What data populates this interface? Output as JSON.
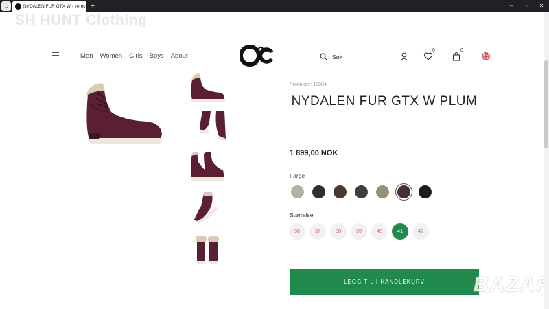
{
  "browser": {
    "tab_title": "NYDALEN FUR GTX W - zeroc",
    "tab_close": "×",
    "new_tab": "+",
    "menu_icon": "chevron-down-icon",
    "window_controls": [
      "–",
      "▫",
      "✕"
    ]
  },
  "watermark": {
    "top": "SH HUNT Clothing",
    "bottom": "BAZAR"
  },
  "header": {
    "nav": [
      "Men",
      "Women",
      "Girls",
      "Boys",
      "About"
    ],
    "logo_text": "O°c",
    "search_label": "Søk",
    "wishlist_count": "0",
    "cart_count": "0"
  },
  "product": {
    "number": "Produktnr: 10004",
    "title": "NYDALEN FUR GTX W PLUM",
    "price": "1 899,00 NOK",
    "color_label": "Farge",
    "colors": [
      {
        "name": "grey",
        "hex": "#b3b1a7",
        "selected": false
      },
      {
        "name": "black",
        "hex": "#2f2f2f",
        "selected": false
      },
      {
        "name": "brown",
        "hex": "#4a3a33",
        "selected": false
      },
      {
        "name": "dark-olive",
        "hex": "#3d413d",
        "selected": false
      },
      {
        "name": "taupe",
        "hex": "#9a8f7c",
        "selected": false
      },
      {
        "name": "plum",
        "hex": "#4b2d34",
        "selected": true
      },
      {
        "name": "black-2",
        "hex": "#1c1c1c",
        "selected": false
      }
    ],
    "size_label": "Størrelse",
    "sizes": [
      {
        "label": "36",
        "available": false
      },
      {
        "label": "37",
        "available": false
      },
      {
        "label": "38",
        "available": false
      },
      {
        "label": "39",
        "available": false
      },
      {
        "label": "40",
        "available": false
      },
      {
        "label": "41",
        "available": true
      },
      {
        "label": "42",
        "available": false
      }
    ],
    "cart_button": "LEGG TIL I HANDLEKURV"
  },
  "colors": {
    "accent_green": "#1f8a4c",
    "plum": "#5a1f33"
  }
}
